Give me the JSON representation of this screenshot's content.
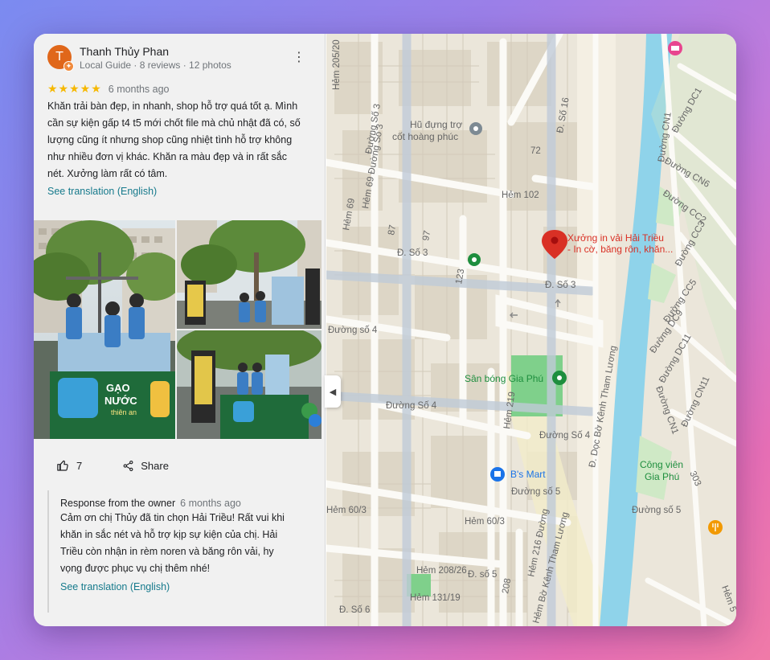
{
  "reviewer": {
    "initial": "T",
    "name": "Thanh Thủy Phan",
    "meta": "Local Guide · 8 reviews · 12 photos"
  },
  "review": {
    "stars": "★★★★★",
    "rating": 5,
    "time": "6 months ago",
    "text": "Khăn trải bàn đẹp, in nhanh, shop hỗ trợ quá tốt ạ. Mình cần sự kiện gấp t4 t5 mới chốt file mà chủ nhật đã có, số lượng cũng ít nhưng shop cũng nhiệt tình hỗ trợ không như nhiều đơn vị khác. Khăn ra màu đẹp và in rất sắc nét. Xưởng làm rất có tâm.",
    "translate": "See translation (English)"
  },
  "photo_banner": {
    "brand_line1": "GẠO",
    "brand_line2": "NƯỚC",
    "brand_line3": "thiên an"
  },
  "actions": {
    "like_count": "7",
    "share": "Share"
  },
  "response": {
    "label": "Response from the owner",
    "time": "6 months ago",
    "text": "Cảm ơn chị Thủy đã tin chọn Hải Triều! Rất vui khi khăn in sắc nét và hỗ trợ kịp sự kiện của chị. Hải Triều còn nhận in rèm noren và băng rôn vải, hy vọng được phục vụ chị thêm nhé!",
    "translate": "See translation (English)"
  },
  "map": {
    "pin_title_line1": "Xưởng in vải Hải Triều",
    "pin_title_line2": "- In cờ, băng rôn, khăn...",
    "poi_cot_line1": "Hũ đựng trợ",
    "poi_cot_line2": "cốt hoàng phúc",
    "poi_field": "Sân bóng Gia Phú",
    "poi_mart": "B's Mart",
    "poi_park_line1": "Công viên",
    "poi_park_line2": "Gia Phú",
    "labels": {
      "hem_205_20": "Hẻm 205/20",
      "duong_so_3_top": "Đường Số 3",
      "d_so_16": "Đ. Số 16",
      "hem_69_duong_so_3": "Hẻm 69 Đường Số 3",
      "n72": "72",
      "hem_102": "Hẻm 102",
      "hem_69": "Hẻm 69",
      "n87": "87",
      "n97": "97",
      "d_so_3_a": "Đ. Số 3",
      "n123": "123",
      "d_so_3_b": "Đ. Số 3",
      "duong_so_4_a": "Đường số 4",
      "duong_so_4_b": "Đường Số 4",
      "duong_so_4_c": "Đường Số 4",
      "hem_219": "Hẻm 219",
      "d_doc_kenh": "Đ. Dọc Bờ Kênh Tham Lương",
      "duong_so_5_a": "Đường số 5",
      "duong_so_5_b": "Đường số 5",
      "hem_60_3_a": "Hẻm 60/3",
      "hem_60_3_b": "Hẻm 60/3",
      "hem_216": "Hẻm 216 Đường",
      "hem_208_26": "Hẻm 208/26",
      "d_so_5_c": "Đ. số 5",
      "n208": "208",
      "hem_131_19": "Hẻm 131/19",
      "hem_bo_kenh": "Hẻm Bờ Kênh Tham Lương",
      "d_so_6": "Đ. Số 6",
      "duong_cn1": "Đường CN1",
      "duong_dc1": "Đường DC1",
      "duong_cn6": "Đường CN6",
      "duong_cc2": "Đường CC2",
      "duong_cc3": "Đường CC3",
      "duong_cc5": "Đường CC5",
      "duong_dc9": "Đường DC9",
      "duong_dc11": "Đường DC11",
      "duong_cn1_b": "Đường CN1",
      "duong_cn11": "Đường CN11",
      "n303": "303",
      "hem_5": "Hẻm 5"
    }
  },
  "colors": {
    "accent_link": "#167a8c",
    "star": "#f6b800",
    "avatar": "#e0671a",
    "pin": "#d93025",
    "river": "#8fd3ea"
  }
}
